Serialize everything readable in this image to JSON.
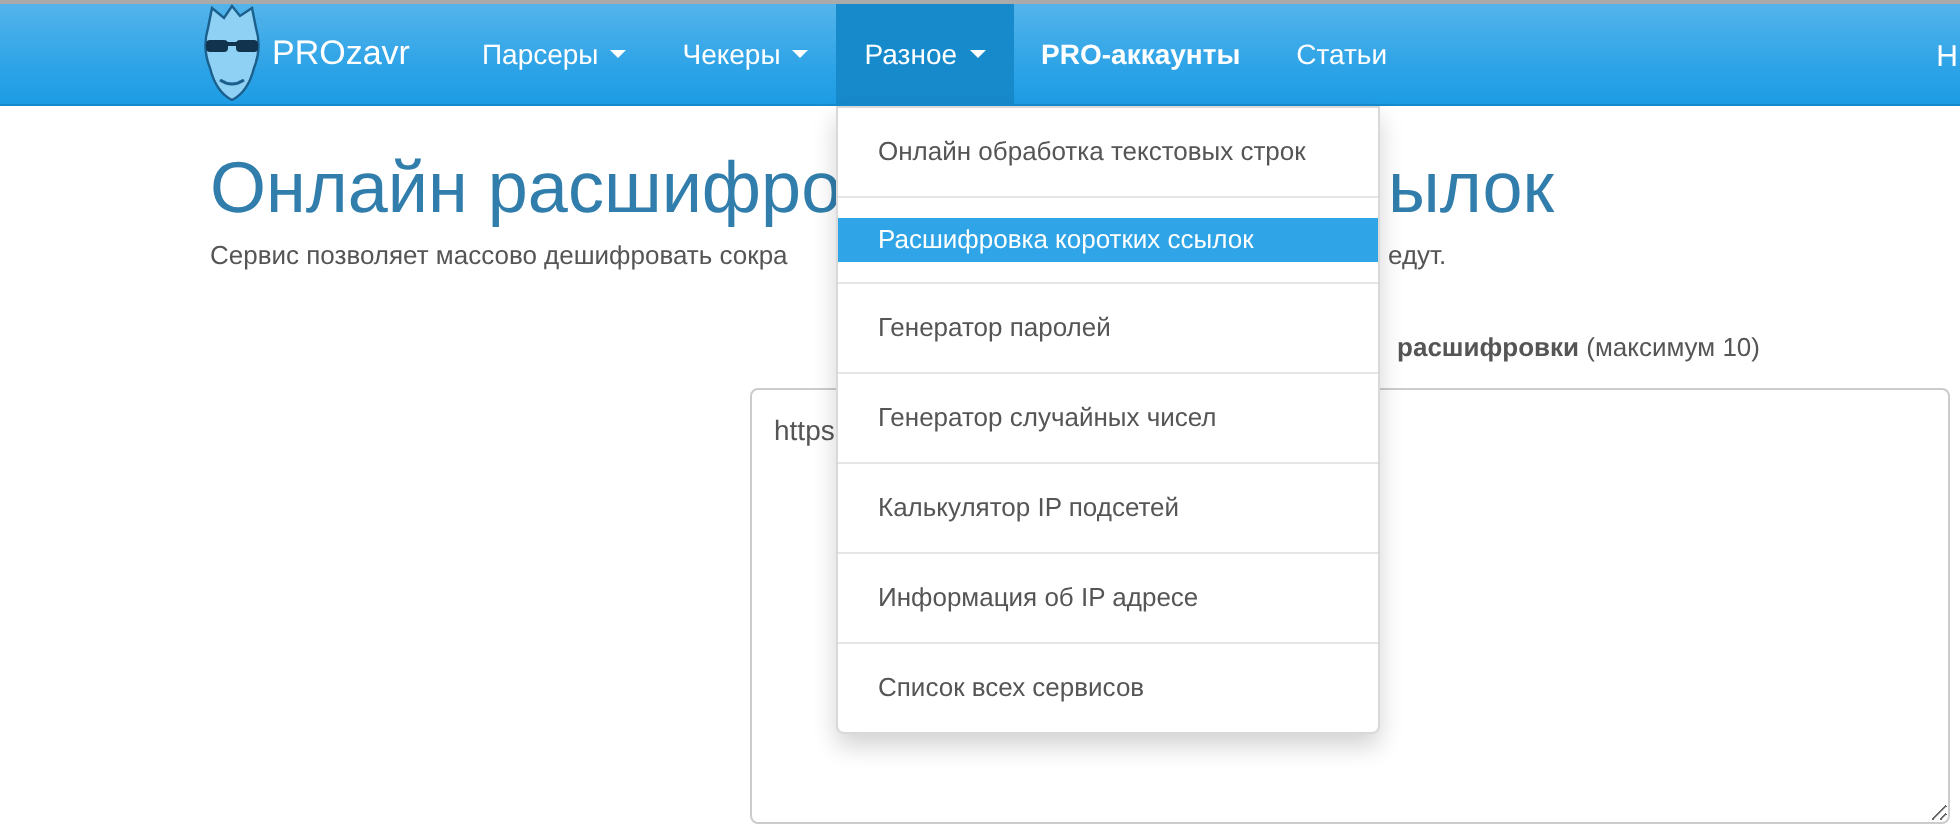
{
  "navbar": {
    "brand": "PROzavr",
    "items": [
      {
        "label": "Парсеры",
        "kind": "dropdown",
        "selected": false
      },
      {
        "label": "Чекеры",
        "kind": "dropdown",
        "selected": false
      },
      {
        "label": "Разное",
        "kind": "dropdown",
        "selected": true
      },
      {
        "label": "PRO-аккаунты",
        "kind": "featured",
        "selected": false
      },
      {
        "label": "Статьи",
        "kind": "link",
        "selected": false
      }
    ],
    "edge_item": "Н"
  },
  "dropdown_menu": {
    "items": [
      {
        "label": "Онлайн обработка текстовых строк",
        "selected": false
      },
      {
        "label": "Расшифровка коротких ссылок",
        "selected": true
      },
      {
        "label": "Генератор паролей",
        "selected": false
      },
      {
        "label": "Генератор случайных чисел",
        "selected": false
      },
      {
        "label": "Калькулятор IP подсетей",
        "selected": false
      },
      {
        "label": "Информация об IP адресе",
        "selected": false
      },
      {
        "label": "Список всех сервисов",
        "selected": false
      }
    ]
  },
  "heading": {
    "visible_parts": [
      "Онлайн расшифро",
      "ылок"
    ]
  },
  "subtitle": {
    "visible_parts": [
      "Сервис позволяет массово дешифровать сокра",
      "едут."
    ]
  },
  "form": {
    "label": "**расшифровки** (максимум 10)",
    "textarea": {
      "value": "https"
    }
  }
}
